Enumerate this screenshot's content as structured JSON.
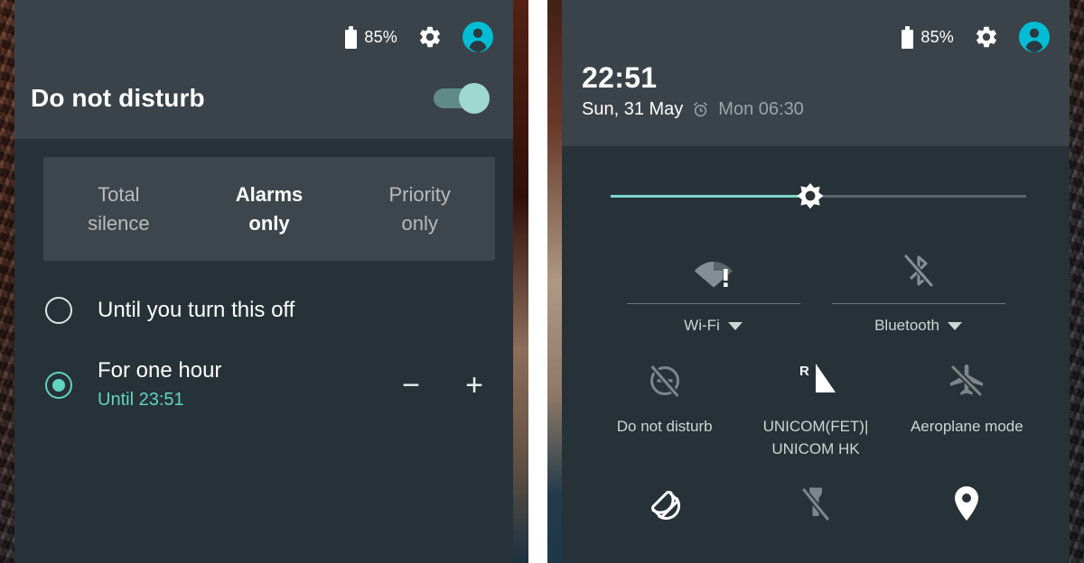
{
  "theme": {
    "header_bg": "#3b434a",
    "body_bg": "#263238",
    "segment_bg": "#3d464c",
    "accent_teal": "#63d2c0",
    "accent_cyan": "#00bcd4",
    "text_primary": "#ffffff",
    "text_secondary": "#b6bcc0",
    "slider_fill": "#7fd6cc"
  },
  "left_panel": {
    "status_bar": {
      "battery_icon": "battery-icon",
      "battery_level": "85%",
      "settings_icon": "gear-icon",
      "avatar_icon": "user-avatar-icon"
    },
    "title": "Do not disturb",
    "toggle": {
      "name": "dnd-toggle",
      "state": "on"
    },
    "segmented_control": {
      "options": [
        {
          "line1": "Total",
          "line2": "silence",
          "active": false
        },
        {
          "line1": "Alarms",
          "line2": "only",
          "active": true
        },
        {
          "line1": "Priority",
          "line2": "only",
          "active": false
        }
      ]
    },
    "duration_options": [
      {
        "label": "Until you turn this off",
        "sublabel": "",
        "selected": false,
        "has_steppers": false
      },
      {
        "label": "For one hour",
        "sublabel": "Until 23:51",
        "selected": true,
        "has_steppers": true
      }
    ],
    "stepper_decrease": "−",
    "stepper_increase": "+"
  },
  "right_panel": {
    "status_bar": {
      "battery_icon": "battery-icon",
      "battery_level": "85%",
      "settings_icon": "gear-icon",
      "avatar_icon": "user-avatar-icon"
    },
    "clock": {
      "time": "22:51",
      "date": "Sun, 31 May",
      "alarm_icon": "alarm-clock-icon",
      "alarm_time": "Mon 06:30"
    },
    "brightness": {
      "name": "brightness-slider",
      "icon": "brightness-sun-icon",
      "percent": 48
    },
    "connectivity_tiles": [
      {
        "label": "Wi-Fi",
        "icon": "wifi-no-internet-icon",
        "has_caret": true,
        "enabled": false
      },
      {
        "label": "Bluetooth",
        "icon": "bluetooth-off-icon",
        "has_caret": true,
        "enabled": false
      }
    ],
    "quick_tiles_row1": [
      {
        "label": "Do not disturb",
        "icon": "do-not-disturb-off-icon",
        "enabled": false
      },
      {
        "label": "UNICOM(FET)|\nUNICOM HK",
        "label_line1": "UNICOM(FET)|",
        "label_line2": "UNICOM HK",
        "icon": "cellular-roaming-icon",
        "enabled": true
      },
      {
        "label": "Aeroplane mode",
        "icon": "aeroplane-mode-icon",
        "enabled": false
      }
    ],
    "quick_tiles_row2": [
      {
        "label": "",
        "icon": "auto-rotate-icon",
        "enabled": true
      },
      {
        "label": "",
        "icon": "flashlight-off-icon",
        "enabled": false
      },
      {
        "label": "",
        "icon": "location-pin-icon",
        "enabled": true
      }
    ]
  }
}
